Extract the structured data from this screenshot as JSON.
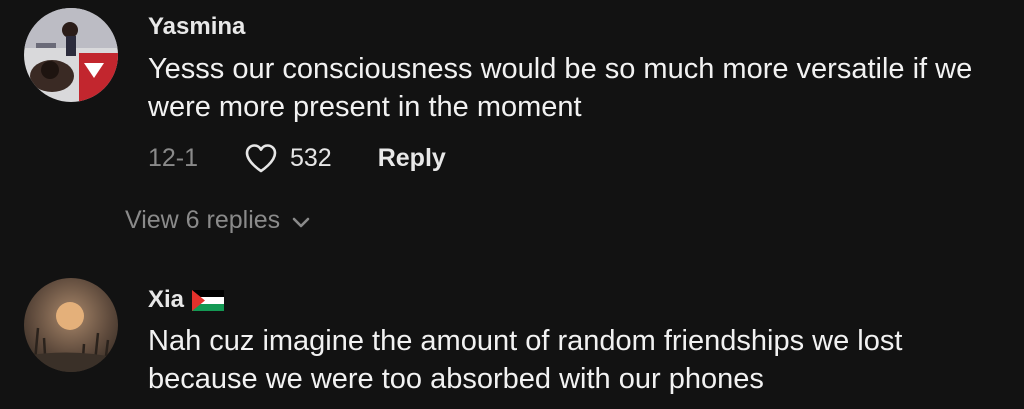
{
  "comments": [
    {
      "username": "Yasmina",
      "text": "Yesss our consciousness would be so much more versatile if we were more present in the moment",
      "timestamp": "12-1",
      "likes": "532",
      "reply_label": "Reply",
      "view_replies_label": "View 6 replies",
      "icons": {
        "like": "heart-outline-icon",
        "expand": "chevron-down-icon"
      }
    },
    {
      "username": "Xia",
      "flag": "palestine-flag",
      "text": "Nah cuz imagine the amount of random friendships we lost because we were too absorbed with our phones"
    }
  ],
  "colors": {
    "background": "#121212",
    "primary_text": "#f2f2f2",
    "secondary_text": "#8a8a8a"
  }
}
